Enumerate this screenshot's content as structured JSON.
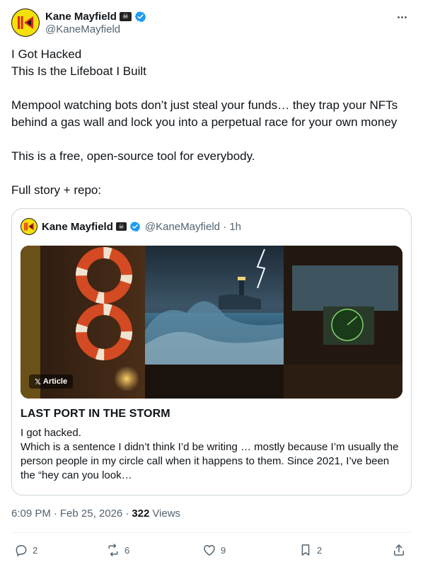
{
  "author": {
    "display_name": "Kane Mayfield",
    "handle": "@KaneMayfield",
    "avatar_icon": "rewind-logo-icon",
    "flag_icon": "skull-crossbones-flag",
    "flag_glyph": "☠",
    "verified_icon": "verified-badge-icon",
    "verified_color": "#1d9bf0",
    "avatar_bg": "#f4e00a",
    "avatar_accent": "#e0241b"
  },
  "more_icon": "more-horizontal-icon",
  "tweet": {
    "lines": [
      "I Got Hacked",
      "This Is the Lifeboat I Built",
      "Mempool watching bots don’t just steal your funds… they trap your NFTs behind a gas wall and lock you into a perpetual race for your own money",
      "This is a free, open-source tool for everybody.",
      "Full story + repo:"
    ]
  },
  "quote": {
    "display_name": "Kane Mayfield",
    "handle_time": "@KaneMayfield · 1h",
    "badge_glyph": "𝕏",
    "badge_label": "Article",
    "article_title": "LAST PORT IN THE STORM",
    "excerpt_line1": "I got hacked.",
    "excerpt_line2": "Which is a sentence I didn’t think I’d be writing … mostly because I’m usually the person people in my circle call when it happens to them. Since 2021, I’ve been the “hey can you look…",
    "image_description_icon": "article-cover-image"
  },
  "meta": {
    "time": "6:09 PM",
    "date": "Feb 25, 2026",
    "separator": "·",
    "views_count": "322",
    "views_label": "Views"
  },
  "actions": {
    "reply": {
      "icon": "reply-icon",
      "count": "2"
    },
    "repost": {
      "icon": "repost-icon",
      "count": "6"
    },
    "like": {
      "icon": "like-icon",
      "count": "9"
    },
    "bookmark": {
      "icon": "bookmark-icon",
      "count": "2"
    },
    "share": {
      "icon": "share-icon"
    }
  },
  "colors": {
    "text_primary": "#0f1419",
    "text_secondary": "#536471",
    "border": "#cfd9de"
  }
}
